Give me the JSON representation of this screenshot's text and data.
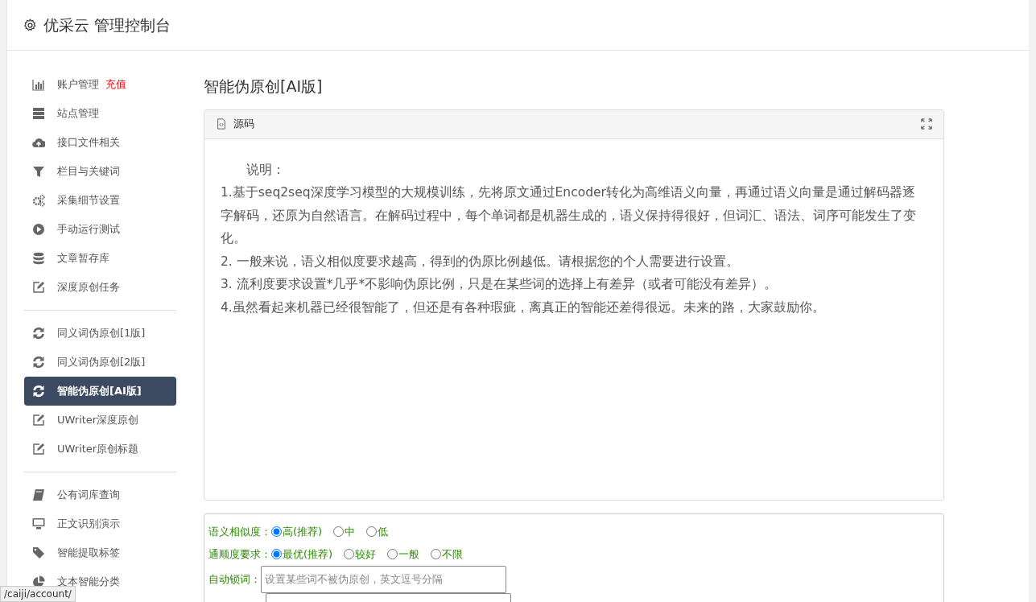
{
  "header": {
    "title": "优采云 管理控制台"
  },
  "sidebar": {
    "groups": [
      {
        "items": [
          {
            "label": "账户管理",
            "badge": "充值",
            "selected": false
          },
          {
            "label": "站点管理",
            "selected": false
          },
          {
            "label": "接口文件相关",
            "selected": false
          },
          {
            "label": "栏目与关键词",
            "selected": false
          },
          {
            "label": "采集细节设置",
            "selected": false
          },
          {
            "label": "手动运行测试",
            "selected": false
          },
          {
            "label": "文章暂存库",
            "selected": false
          },
          {
            "label": "深度原创任务",
            "selected": false
          }
        ]
      },
      {
        "items": [
          {
            "label": "同义词伪原创[1版]",
            "selected": false
          },
          {
            "label": "同义词伪原创[2版]",
            "selected": false
          },
          {
            "label": "智能伪原创[AI版]",
            "selected": true
          },
          {
            "label": "UWriter深度原创",
            "selected": false
          },
          {
            "label": "UWriter原创标题",
            "selected": false
          }
        ]
      },
      {
        "items": [
          {
            "label": "公有词库查询",
            "selected": false
          },
          {
            "label": "正文识别演示",
            "selected": false
          },
          {
            "label": "智能提取标签",
            "selected": false
          },
          {
            "label": "文本智能分类",
            "selected": false
          }
        ]
      }
    ]
  },
  "content": {
    "title": "智能伪原创[AI版]",
    "editor": {
      "toolbar_label": "源码",
      "paragraphs": [
        "说明：",
        "1.基于seq2seq深度学习模型的大规模训练，先将原文通过Encoder转化为高维语义向量，再通过语义向量是通过解码器逐字解码，还原为自然语言。在解码过程中，每个单词都是机器生成的，语义保持得很好，但词汇、语法、词序可能发生了变化。",
        "2. 一般来说，语义相似度要求越高，得到的伪原比例越低。请根据您的个人需要进行设置。",
        "3. 流利度要求设置*几乎*不影响伪原比例，只是在某些词的选择上有差异（或者可能没有差异）。",
        "4.虽然看起来机器已经很智能了，但还是有各种瑕疵，离真正的智能还差得很远。未来的路，大家鼓励你。"
      ]
    },
    "form": [
      {
        "kind": "radio",
        "label": "语义相似度：",
        "options": [
          {
            "label": "高(推荐)",
            "selected": true
          },
          {
            "label": "中",
            "selected": false
          },
          {
            "label": "低",
            "selected": false
          }
        ]
      },
      {
        "kind": "radio",
        "label": "通顺度要求：",
        "options": [
          {
            "label": "最优(推荐)",
            "selected": true
          },
          {
            "label": "较好",
            "selected": false
          },
          {
            "label": "一般",
            "selected": false
          },
          {
            "label": "不限",
            "selected": false
          }
        ]
      },
      {
        "kind": "input",
        "label": "自动锁词：",
        "placeholder": "设置某些词不被伪原创，英文逗号分隔"
      },
      {
        "kind": "input"
      }
    ]
  },
  "status_bar": {
    "url": "/caiji/account/"
  }
}
